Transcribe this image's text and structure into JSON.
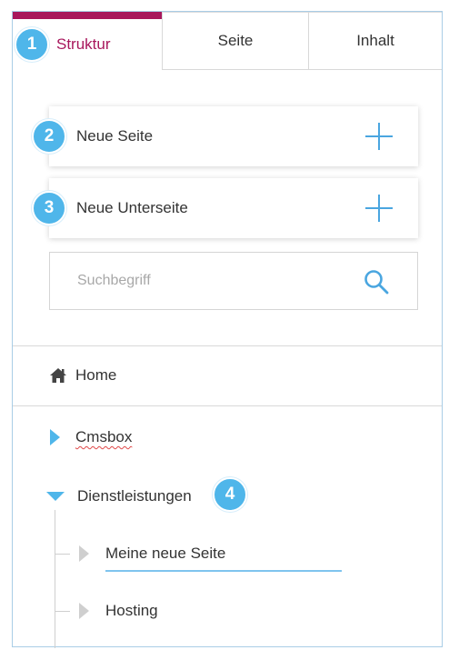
{
  "tabs": [
    {
      "label": "Struktur",
      "active": true
    },
    {
      "label": "Seite",
      "active": false
    },
    {
      "label": "Inhalt",
      "active": false
    }
  ],
  "badges": [
    "1",
    "2",
    "3",
    "4"
  ],
  "actions": {
    "new_page_label": "Neue Seite",
    "new_subpage_label": "Neue Unterseite"
  },
  "search": {
    "placeholder": "Suchbegriff",
    "value": ""
  },
  "tree": {
    "home_label": "Home",
    "items": [
      {
        "label": "Cmsbox",
        "expanded": false
      },
      {
        "label": "Dienstleistungen",
        "expanded": true
      }
    ],
    "children": [
      {
        "label": "Meine neue Seite",
        "editing": true
      },
      {
        "label": "Hosting",
        "editing": false
      }
    ]
  },
  "colors": {
    "accent": "#a8175c",
    "badge": "#4fb6ea",
    "plus": "#4aa6e0",
    "border": "#a9cde6"
  },
  "icons": [
    "plus-icon",
    "search-icon",
    "home-icon",
    "caret-right-icon",
    "caret-down-icon"
  ]
}
